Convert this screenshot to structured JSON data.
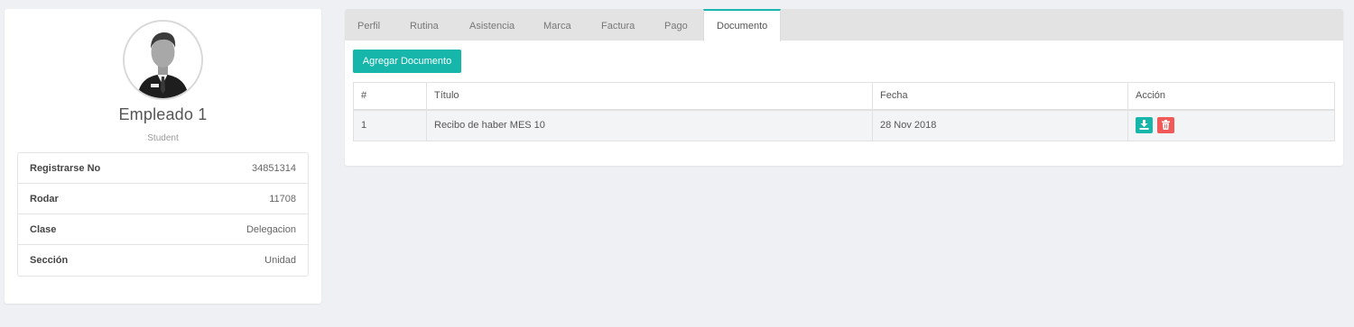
{
  "profile": {
    "name": "Empleado 1",
    "role": "Student",
    "avatar_icon": "user-avatar-icon",
    "details": [
      {
        "label": "Registrarse No",
        "value": "34851314"
      },
      {
        "label": "Rodar",
        "value": "11708"
      },
      {
        "label": "Clase",
        "value": "Delegacion"
      },
      {
        "label": "Sección",
        "value": "Unidad"
      }
    ]
  },
  "tabs": [
    {
      "label": "Perfil"
    },
    {
      "label": "Rutina"
    },
    {
      "label": "Asistencia"
    },
    {
      "label": "Marca"
    },
    {
      "label": "Factura"
    },
    {
      "label": "Pago"
    },
    {
      "label": "Documento",
      "active": true
    }
  ],
  "documents": {
    "add_button_label": "Agregar Documento",
    "columns": [
      "#",
      "Título",
      "Fecha",
      "Acción"
    ],
    "rows": [
      {
        "num": "1",
        "title": "Recibo de haber MES 10",
        "date": "28 Nov 2018",
        "actions": [
          "download-icon",
          "trash-icon"
        ]
      }
    ]
  },
  "colors": {
    "accent": "#17b6aa",
    "danger": "#f25a5a",
    "background": "#eef0f4"
  }
}
